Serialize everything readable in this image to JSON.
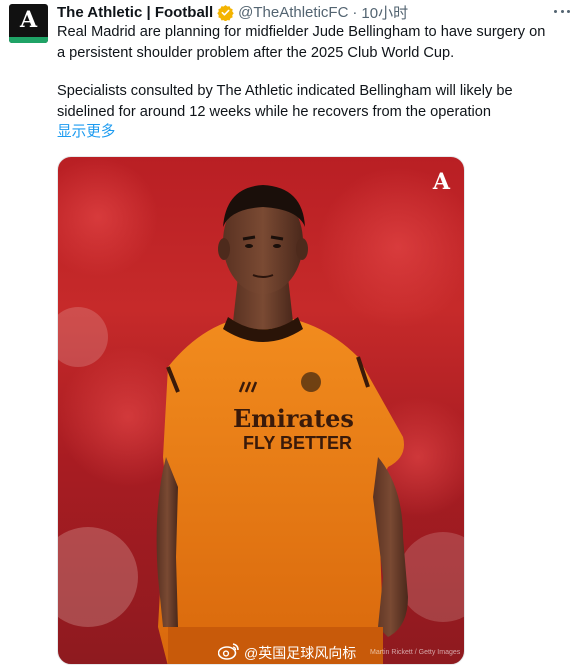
{
  "account": {
    "name": "The Athletic | Football",
    "handle": "@TheAthleticFC",
    "separator": "·",
    "time": "10小时",
    "avatar_icon": "athletic-logo",
    "avatar_letter": "A",
    "verified_color": "#f4b400"
  },
  "tweet": {
    "paragraph1": [
      "Real Madrid are planning for midfielder Jude Bellingham to have surgery on",
      "a persistent shoulder problem after the 2025 Club World Cup."
    ],
    "paragraph2": [
      "Specialists consulted by The Athletic indicated Bellingham will likely be",
      "sidelined for around 12 weeks while he recovers from the operation"
    ],
    "show_more": "显示更多"
  },
  "media": {
    "brand_mark": "A",
    "shirt_sponsor_top": "Emirates",
    "shirt_sponsor_bottom": "FLY BETTER",
    "watermark_text": "@英国足球风向标",
    "watermark_icon": "weibo-icon",
    "credit": "Martin Rickett / Getty Images"
  },
  "colors": {
    "link": "#1d9bf0",
    "secondary_text": "#536471",
    "avatar_accent": "#1fa366"
  }
}
